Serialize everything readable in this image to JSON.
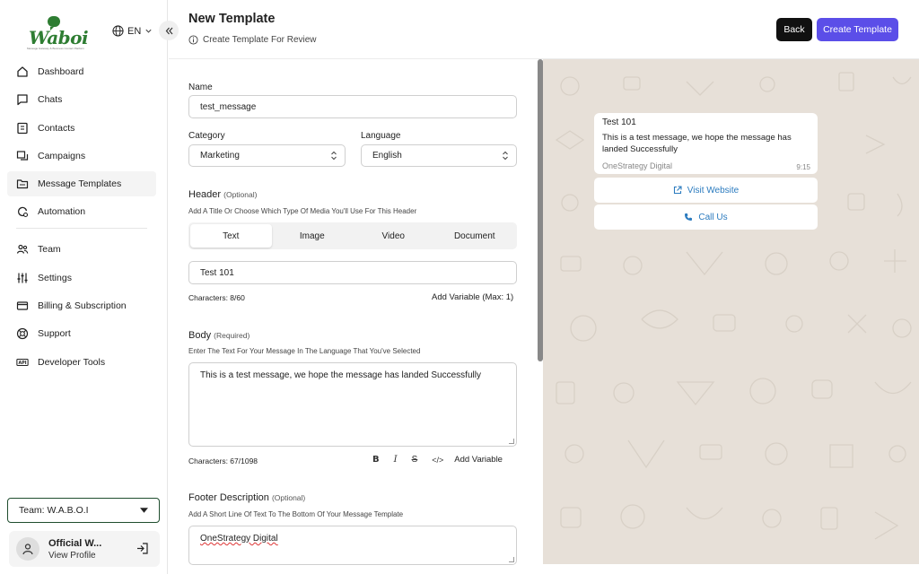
{
  "brand": {
    "name": "Waboi",
    "tagline": "Message Gateway & Business Contact Platform"
  },
  "lang": {
    "code": "EN"
  },
  "nav": {
    "items": [
      {
        "label": "Dashboard"
      },
      {
        "label": "Chats"
      },
      {
        "label": "Contacts"
      },
      {
        "label": "Campaigns"
      },
      {
        "label": "Message Templates"
      },
      {
        "label": "Automation"
      },
      {
        "label": "Team"
      },
      {
        "label": "Settings"
      },
      {
        "label": "Billing & Subscription"
      },
      {
        "label": "Support"
      },
      {
        "label": "Developer Tools"
      }
    ]
  },
  "team": {
    "label": "Team: W.A.B.O.I"
  },
  "profile": {
    "name": "Official W...",
    "link": "View Profile"
  },
  "header": {
    "title": "New Template",
    "subtitle": "Create Template For Review",
    "back_label": "Back",
    "create_label": "Create Template"
  },
  "form": {
    "name_label": "Name",
    "name_value": "test_message",
    "category_label": "Category",
    "category_value": "Marketing",
    "language_label": "Language",
    "language_value": "English",
    "header_title": "Header",
    "header_opt": "(Optional)",
    "header_hint": "Add A Title Or Choose Which Type Of Media You'll Use For This Header",
    "tabs": [
      "Text",
      "Image",
      "Video",
      "Document"
    ],
    "header_value": "Test 101",
    "header_count": "Characters: 8/60",
    "header_add_var": "Add Variable (Max: 1)",
    "body_title": "Body",
    "body_req": "(Required)",
    "body_hint": "Enter The Text For Your Message In The Language That You've Selected",
    "body_value": "This is a test message, we hope the message has landed Successfully",
    "body_count": "Characters: 67/1098",
    "body_add_var": "Add Variable",
    "footer_title": "Footer Description",
    "footer_opt": "(Optional)",
    "footer_hint": "Add A Short Line Of Text To The Bottom Of Your Message Template",
    "footer_value": "OneStrategy Digital"
  },
  "preview": {
    "title": "Test 101",
    "body": "This is a test message, we hope the message has landed Successfully",
    "footer": "OneStrategy Digital",
    "time": "9:15",
    "btn1": "Visit Website",
    "btn2": "Call Us"
  },
  "colors": {
    "accent": "#5b4ee8",
    "brand": "#2e7d32",
    "link": "#2b7bbf",
    "preview_bg": "#e7e0d8"
  }
}
